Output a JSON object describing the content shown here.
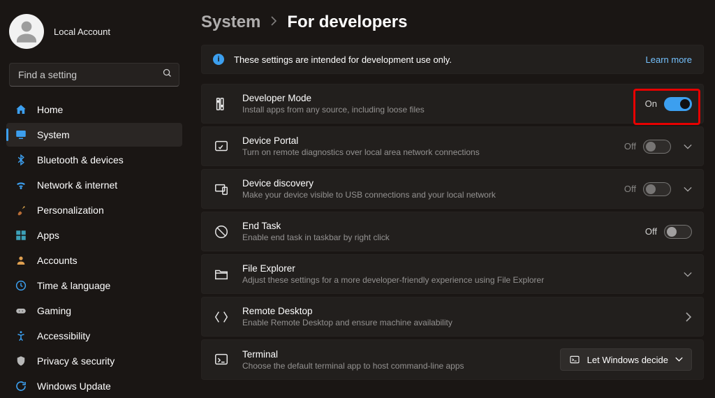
{
  "account": {
    "label": "Local Account"
  },
  "search": {
    "placeholder": "Find a setting"
  },
  "sidebar": {
    "items": [
      {
        "label": "Home"
      },
      {
        "label": "System"
      },
      {
        "label": "Bluetooth & devices"
      },
      {
        "label": "Network & internet"
      },
      {
        "label": "Personalization"
      },
      {
        "label": "Apps"
      },
      {
        "label": "Accounts"
      },
      {
        "label": "Time & language"
      },
      {
        "label": "Gaming"
      },
      {
        "label": "Accessibility"
      },
      {
        "label": "Privacy & security"
      },
      {
        "label": "Windows Update"
      }
    ]
  },
  "breadcrumb": {
    "root": "System",
    "leaf": "For developers"
  },
  "banner": {
    "text": "These settings are intended for development use only.",
    "link": "Learn more"
  },
  "rows": {
    "devmode": {
      "title": "Developer Mode",
      "sub": "Install apps from any source, including loose files",
      "state": "On"
    },
    "portal": {
      "title": "Device Portal",
      "sub": "Turn on remote diagnostics over local area network connections",
      "state": "Off"
    },
    "discovery": {
      "title": "Device discovery",
      "sub": "Make your device visible to USB connections and your local network",
      "state": "Off"
    },
    "endtask": {
      "title": "End Task",
      "sub": "Enable end task in taskbar by right click",
      "state": "Off"
    },
    "explorer": {
      "title": "File Explorer",
      "sub": "Adjust these settings for a more developer-friendly experience using File Explorer"
    },
    "remote": {
      "title": "Remote Desktop",
      "sub": "Enable Remote Desktop and ensure machine availability"
    },
    "terminal": {
      "title": "Terminal",
      "sub": "Choose the default terminal app to host command-line apps",
      "dropdown": "Let Windows decide"
    }
  }
}
